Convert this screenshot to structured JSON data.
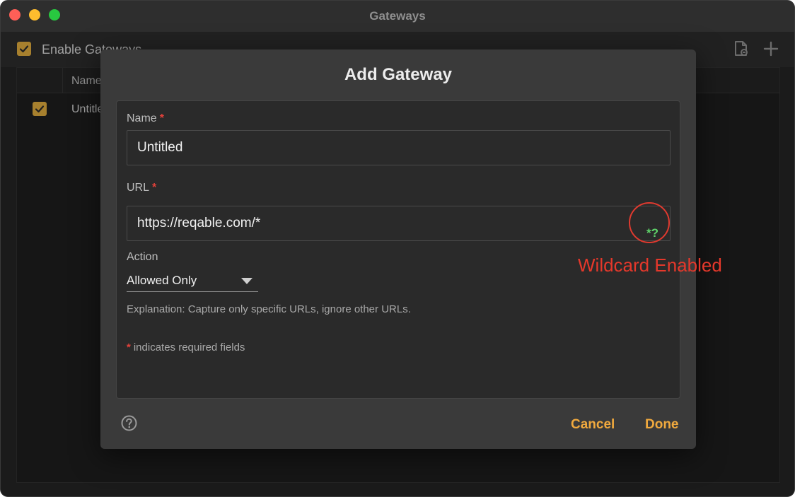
{
  "window": {
    "title": "Gateways"
  },
  "toolbar": {
    "enable_label": "Enable Gateways",
    "enable_checked": true,
    "import_icon": "document-import-icon",
    "add_icon": "plus-icon"
  },
  "list": {
    "column_name": "Name",
    "rows": [
      {
        "checked": true,
        "name": "Untitled"
      }
    ]
  },
  "dialog": {
    "title": "Add Gateway",
    "name_label": "Name",
    "name_value": "Untitled",
    "url_label": "URL",
    "url_value": "https://reqable.com/*",
    "wildcard_button": "*?",
    "action_label": "Action",
    "action_value": "Allowed Only",
    "explanation": "Explanation: Capture only specific URLs, ignore other URLs.",
    "required_star": "*",
    "required_note": "indicates required fields",
    "help_icon": "question-circle-icon",
    "cancel_label": "Cancel",
    "done_label": "Done"
  },
  "annotation": {
    "text": "Wildcard Enabled"
  },
  "colors": {
    "accent": "#f0a93e",
    "checkbox": "#d6a43b",
    "required": "#e2413a",
    "wildcard": "#5fd46a",
    "annotation": "#e5382b"
  }
}
